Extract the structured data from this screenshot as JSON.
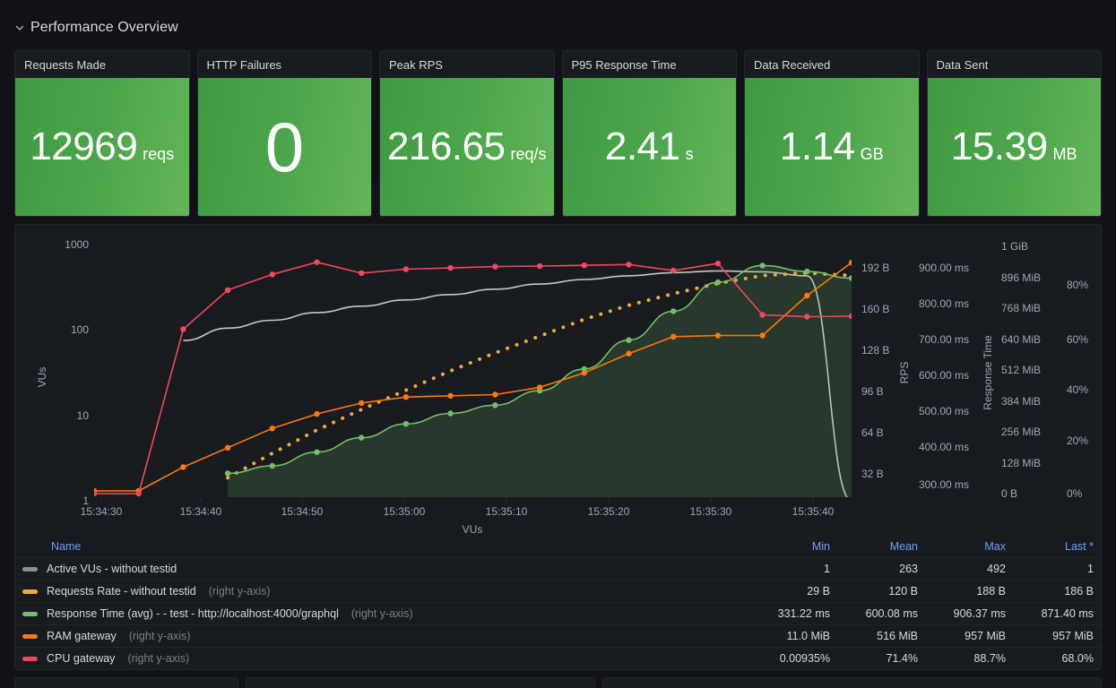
{
  "row": {
    "title": "Performance Overview",
    "collapse_icon": "chevron-down-icon",
    "expanded": true
  },
  "stats": [
    {
      "title": "Requests Made",
      "value": "12969",
      "unit": "reqs",
      "color": "#4aa44a",
      "big": false
    },
    {
      "title": "HTTP Failures",
      "value": "0",
      "unit": "",
      "color": "#4aa44a",
      "big": true
    },
    {
      "title": "Peak RPS",
      "value": "216.65",
      "unit": "req/s",
      "color": "#4aa44a",
      "big": false
    },
    {
      "title": "P95 Response Time",
      "value": "2.41",
      "unit": "s",
      "color": "#4aa44a",
      "big": false
    },
    {
      "title": "Data Received",
      "value": "1.14",
      "unit": "GB",
      "color": "#4aa44a",
      "big": false
    },
    {
      "title": "Data Sent",
      "value": "15.39",
      "unit": "MB",
      "color": "#4aa44a",
      "big": false
    }
  ],
  "legend": {
    "columns": [
      "Name",
      "Min",
      "Mean",
      "Max",
      "Last *"
    ],
    "rows": [
      {
        "color": "#8e8e8e",
        "name": "Active VUs - without testid",
        "axis": "",
        "min": "1",
        "mean": "263",
        "max": "492",
        "last": "1"
      },
      {
        "color": "#f2a93b",
        "name": "Requests Rate - without testid",
        "axis": "(right y-axis)",
        "min": "29 B",
        "mean": "120 B",
        "max": "188 B",
        "last": "186 B"
      },
      {
        "color": "#73bf69",
        "name": "Response Time (avg) - - test - http://localhost:4000/graphql",
        "axis": "(right y-axis)",
        "min": "331.22 ms",
        "mean": "600.08 ms",
        "max": "906.37 ms",
        "last": "871.40 ms"
      },
      {
        "color": "#ff780a",
        "name": "RAM gateway",
        "axis": "(right y-axis)",
        "min": "11.0 MiB",
        "mean": "516 MiB",
        "max": "957 MiB",
        "last": "957 MiB"
      },
      {
        "color": "#f2495c",
        "name": "CPU gateway",
        "axis": "(right y-axis)",
        "min": "0.00935%",
        "mean": "71.4%",
        "max": "88.7%",
        "last": "68.0%"
      }
    ]
  },
  "chart_data": {
    "type": "line",
    "title": "",
    "xlabel": "VUs",
    "x_ticks": [
      "15:34:30",
      "15:34:40",
      "15:34:50",
      "15:35:00",
      "15:35:10",
      "15:35:20",
      "15:35:30",
      "15:35:40"
    ],
    "grid": false,
    "legend_position": "bottom-table",
    "axes": [
      {
        "id": "vus",
        "side": "left",
        "label": "VUs",
        "scale": "log",
        "ticks": [
          "1000",
          "100",
          "10",
          "1"
        ],
        "tick_values": [
          1000,
          100,
          10,
          1
        ]
      },
      {
        "id": "rps",
        "side": "right",
        "label": "RPS",
        "scale": "linear",
        "ticks": [
          "192 B",
          "160 B",
          "128 B",
          "96 B",
          "64 B",
          "32 B"
        ],
        "tick_values": [
          192,
          160,
          128,
          96,
          64,
          32
        ],
        "unit": "bytes"
      },
      {
        "id": "response_time",
        "side": "right",
        "label": "Response Time",
        "scale": "linear",
        "ticks": [
          "900.00 ms",
          "800.00 ms",
          "700.00 ms",
          "600.00 ms",
          "500.00 ms",
          "400.00 ms",
          "300.00 ms"
        ],
        "tick_values": [
          900,
          800,
          700,
          600,
          500,
          400,
          300
        ],
        "unit": "ms"
      },
      {
        "id": "memory",
        "side": "right",
        "label": "",
        "scale": "linear",
        "ticks": [
          "1 GiB",
          "896 MiB",
          "768 MiB",
          "640 MiB",
          "512 MiB",
          "384 MiB",
          "256 MiB",
          "128 MiB",
          "0 B"
        ],
        "tick_values": [
          1024,
          896,
          768,
          640,
          512,
          384,
          256,
          128,
          0
        ],
        "unit": "MiB"
      },
      {
        "id": "percent",
        "side": "right",
        "label": "",
        "scale": "linear",
        "ticks": [
          "80%",
          "60%",
          "40%",
          "20%",
          "0%"
        ],
        "tick_values": [
          80,
          60,
          40,
          20,
          0
        ],
        "unit": "percent"
      }
    ],
    "series": [
      {
        "name": "Active VUs - without testid",
        "color": "#c7c7c7",
        "axis": "vus",
        "style": "solid",
        "points": false,
        "fill": false,
        "values": [
          null,
          null,
          75,
          105,
          130,
          160,
          190,
          225,
          260,
          300,
          345,
          390,
          430,
          470,
          492,
          480,
          430,
          1
        ]
      },
      {
        "name": "Requests Rate - without testid",
        "color": "#f2a93b",
        "axis": "rps",
        "style": "dashed",
        "points": false,
        "fill": false,
        "values": [
          null,
          null,
          null,
          29,
          48,
          66,
          82,
          97,
          112,
          126,
          139,
          152,
          163,
          172,
          180,
          186,
          188,
          186
        ]
      },
      {
        "name": "Response Time (avg) - - test - http://localhost:4000/graphql",
        "color": "#73bf69",
        "axis": "response_time",
        "style": "solid",
        "points": true,
        "fill": true,
        "values": [
          null,
          null,
          null,
          331.22,
          352,
          390,
          430,
          468,
          497,
          520,
          560,
          620,
          700,
          780,
          860,
          906.37,
          890,
          871.4
        ]
      },
      {
        "name": "RAM gateway",
        "color": "#ff780a",
        "axis": "memory",
        "style": "solid",
        "points": true,
        "fill": false,
        "values": [
          11.0,
          11.0,
          110,
          190,
          270,
          330,
          375,
          400,
          405,
          410,
          440,
          500,
          580,
          650,
          655,
          655,
          820,
          957
        ]
      },
      {
        "name": "CPU gateway",
        "color": "#f2495c",
        "axis": "percent",
        "style": "solid",
        "points": true,
        "fill": false,
        "values": [
          0.00935,
          0.00935,
          63,
          78,
          84,
          88.7,
          84.5,
          86,
          86.5,
          87,
          87.2,
          87.5,
          87.8,
          85.5,
          88.2,
          68.5,
          67.8,
          68.0
        ]
      }
    ]
  }
}
